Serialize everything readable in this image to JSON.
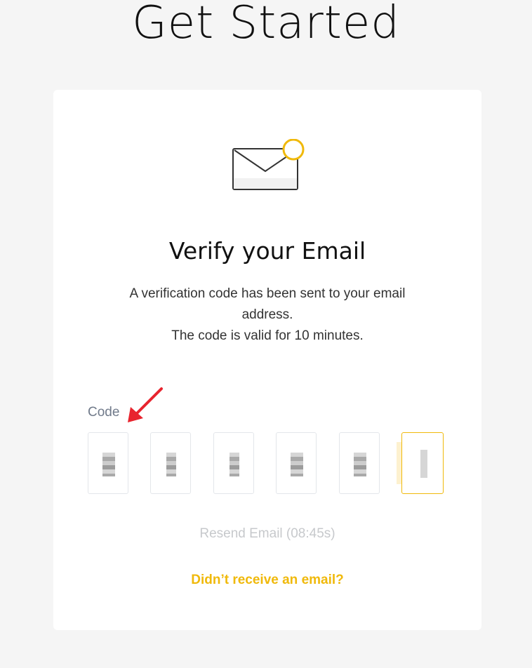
{
  "page": {
    "title": "Get Started"
  },
  "card": {
    "heading": "Verify your Email",
    "description_line1": "A verification code has been sent to your email address.",
    "description_line2": "The code is valid for 10 minutes."
  },
  "code": {
    "label": "Code",
    "digits": [
      "",
      "",
      "",
      "",
      "",
      ""
    ],
    "active_index": 5
  },
  "resend": {
    "label": "Resend Email (08:45s)"
  },
  "help": {
    "label": "Didn’t receive an email?"
  },
  "colors": {
    "accent": "#f0b90b",
    "arrow": "#e8242e",
    "muted_text": "#c7c9cc",
    "box_border": "#e3e6ea"
  },
  "icons": {
    "envelope": "envelope-icon",
    "notification_dot": "notification-dot-icon",
    "annotation_arrow": "arrow-icon"
  }
}
